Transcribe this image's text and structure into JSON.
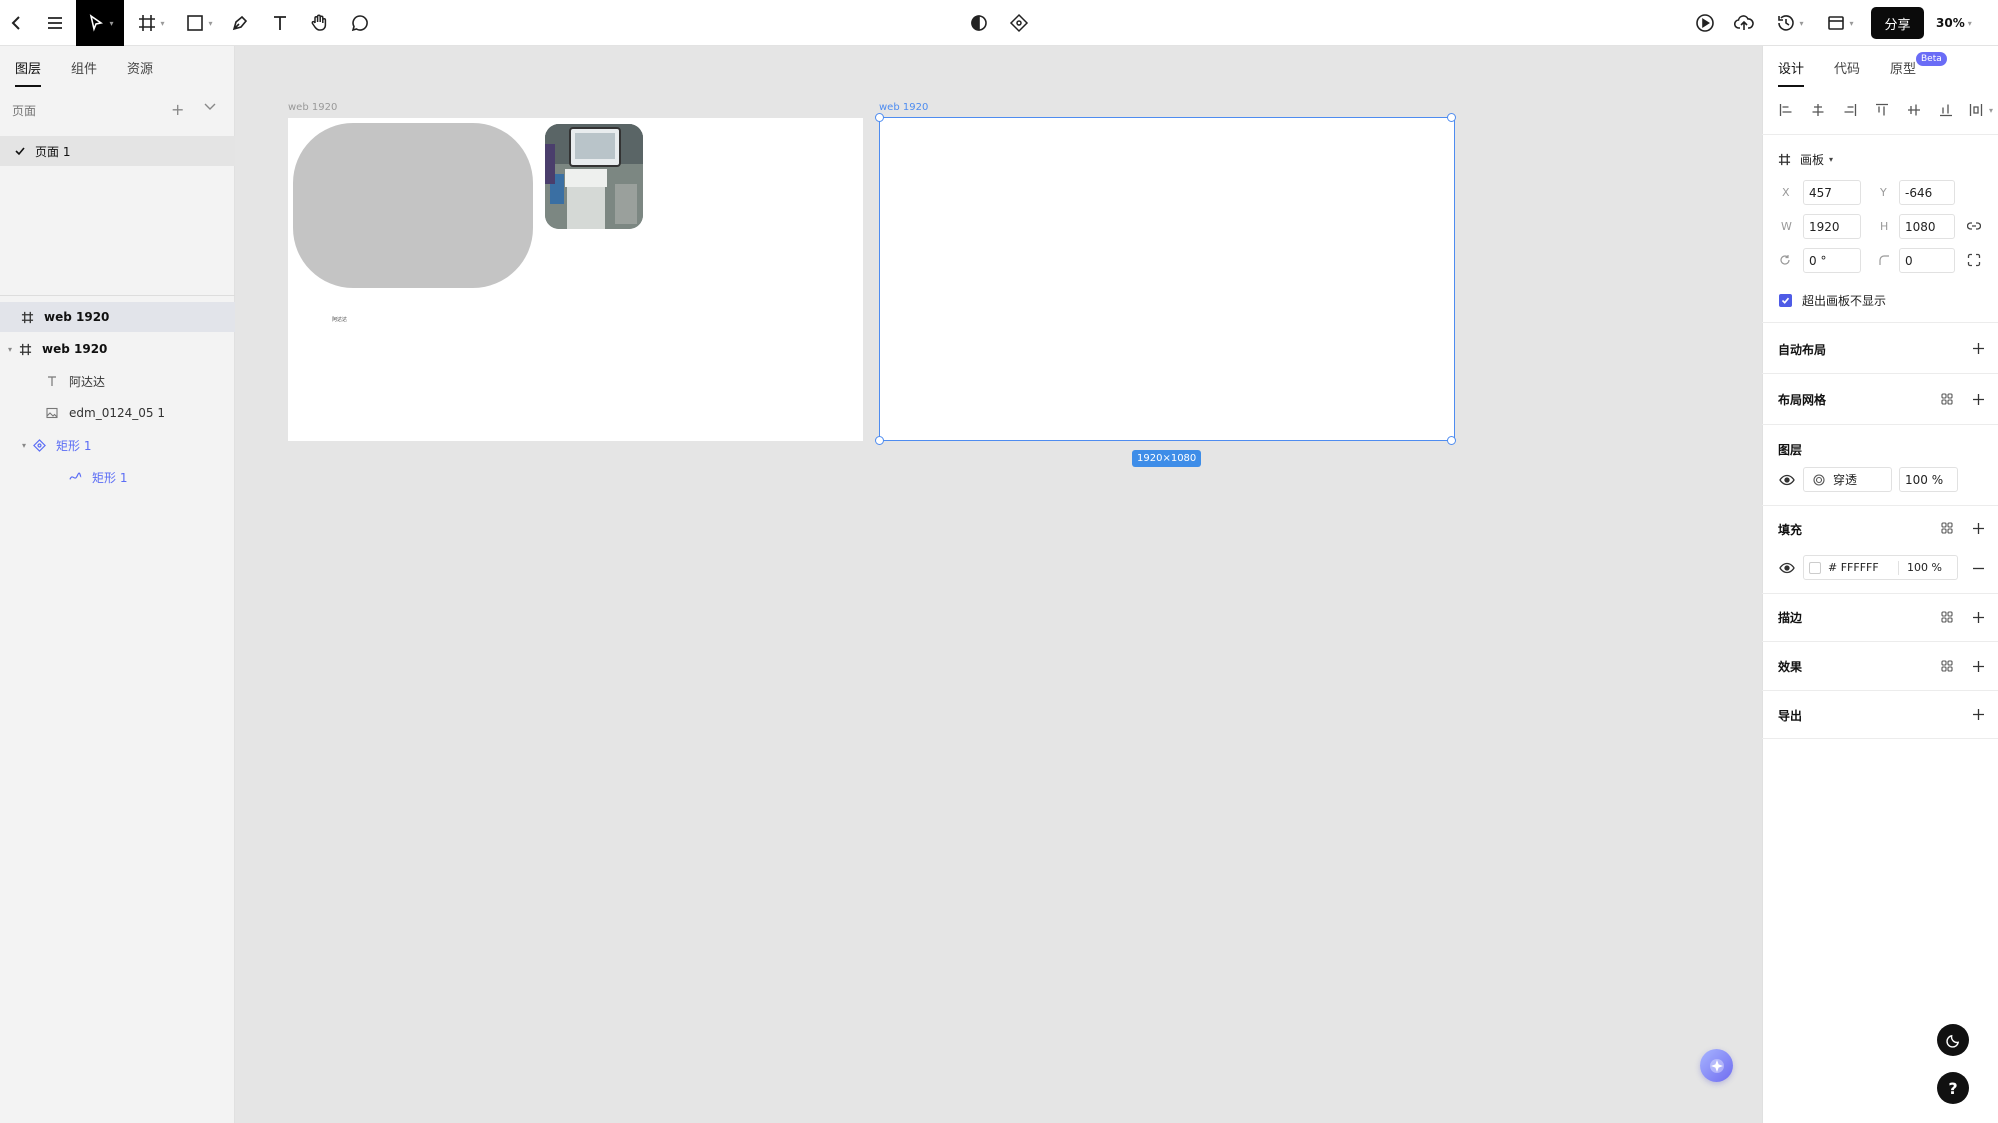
{
  "toolbar": {
    "share_label": "分享",
    "zoom_label": "30%",
    "icons": [
      "back-icon",
      "menu-icon",
      "move-tool-icon",
      "frame-tool-icon",
      "rectangle-tool-icon",
      "pen-tool-icon",
      "text-tool-icon",
      "hand-tool-icon",
      "comment-tool-icon",
      "contrast-icon",
      "dev-mode-icon",
      "play-icon",
      "upload-icon",
      "history-icon",
      "layout-icon"
    ]
  },
  "left_panel": {
    "tabs": [
      {
        "label": "图层",
        "active": true
      },
      {
        "label": "组件",
        "active": false
      },
      {
        "label": "资源",
        "active": false
      }
    ],
    "pages_heading": "页面",
    "pages": [
      {
        "label": "页面 1",
        "selected": true
      }
    ],
    "layers": [
      {
        "label": "web 1920",
        "icon": "frame-icon",
        "selected": true,
        "bold": true
      },
      {
        "label": "web 1920",
        "icon": "frame-icon",
        "expanded": true,
        "bold": true
      },
      {
        "label": "阿达达",
        "icon": "text-layer-icon"
      },
      {
        "label": "edm_0124_05 1",
        "icon": "image-layer-icon"
      },
      {
        "label": "矩形 1",
        "icon": "component-icon",
        "expanded": true,
        "color": "#5b6df5"
      },
      {
        "label": "矩形 1",
        "icon": "vector-icon",
        "color": "#5b6df5"
      }
    ]
  },
  "canvas": {
    "background": "#e5e5e5",
    "frame1_label": "web 1920",
    "frame1_text": "阿达达",
    "frame2_label": "web 1920",
    "selection_size": "1920×1080",
    "selection_color": "#4e8cf0"
  },
  "right_panel": {
    "tabs": [
      {
        "label": "设计",
        "active": true
      },
      {
        "label": "代码",
        "active": false
      },
      {
        "label": "原型",
        "active": false
      }
    ],
    "beta_badge": "Beta",
    "frame_type": "画板",
    "x_label": "X",
    "x_value": "457",
    "y_label": "Y",
    "y_value": "-646",
    "w_label": "W",
    "w_value": "1920",
    "h_label": "H",
    "h_value": "1080",
    "rotation_value": "0 °",
    "radius_value": "0",
    "clip_content_label": "超出画板不显示",
    "clip_content_checked": true,
    "sections": {
      "auto_layout": "自动布局",
      "layout_grid": "布局网格",
      "layer": "图层",
      "fill": "填充",
      "stroke": "描边",
      "effects": "效果",
      "export": "导出"
    },
    "layer_blend": "穿透",
    "layer_opacity": "100 %",
    "fill_hex": "# FFFFFF",
    "fill_opacity": "100 %",
    "accent_color": "#4e5be6"
  }
}
